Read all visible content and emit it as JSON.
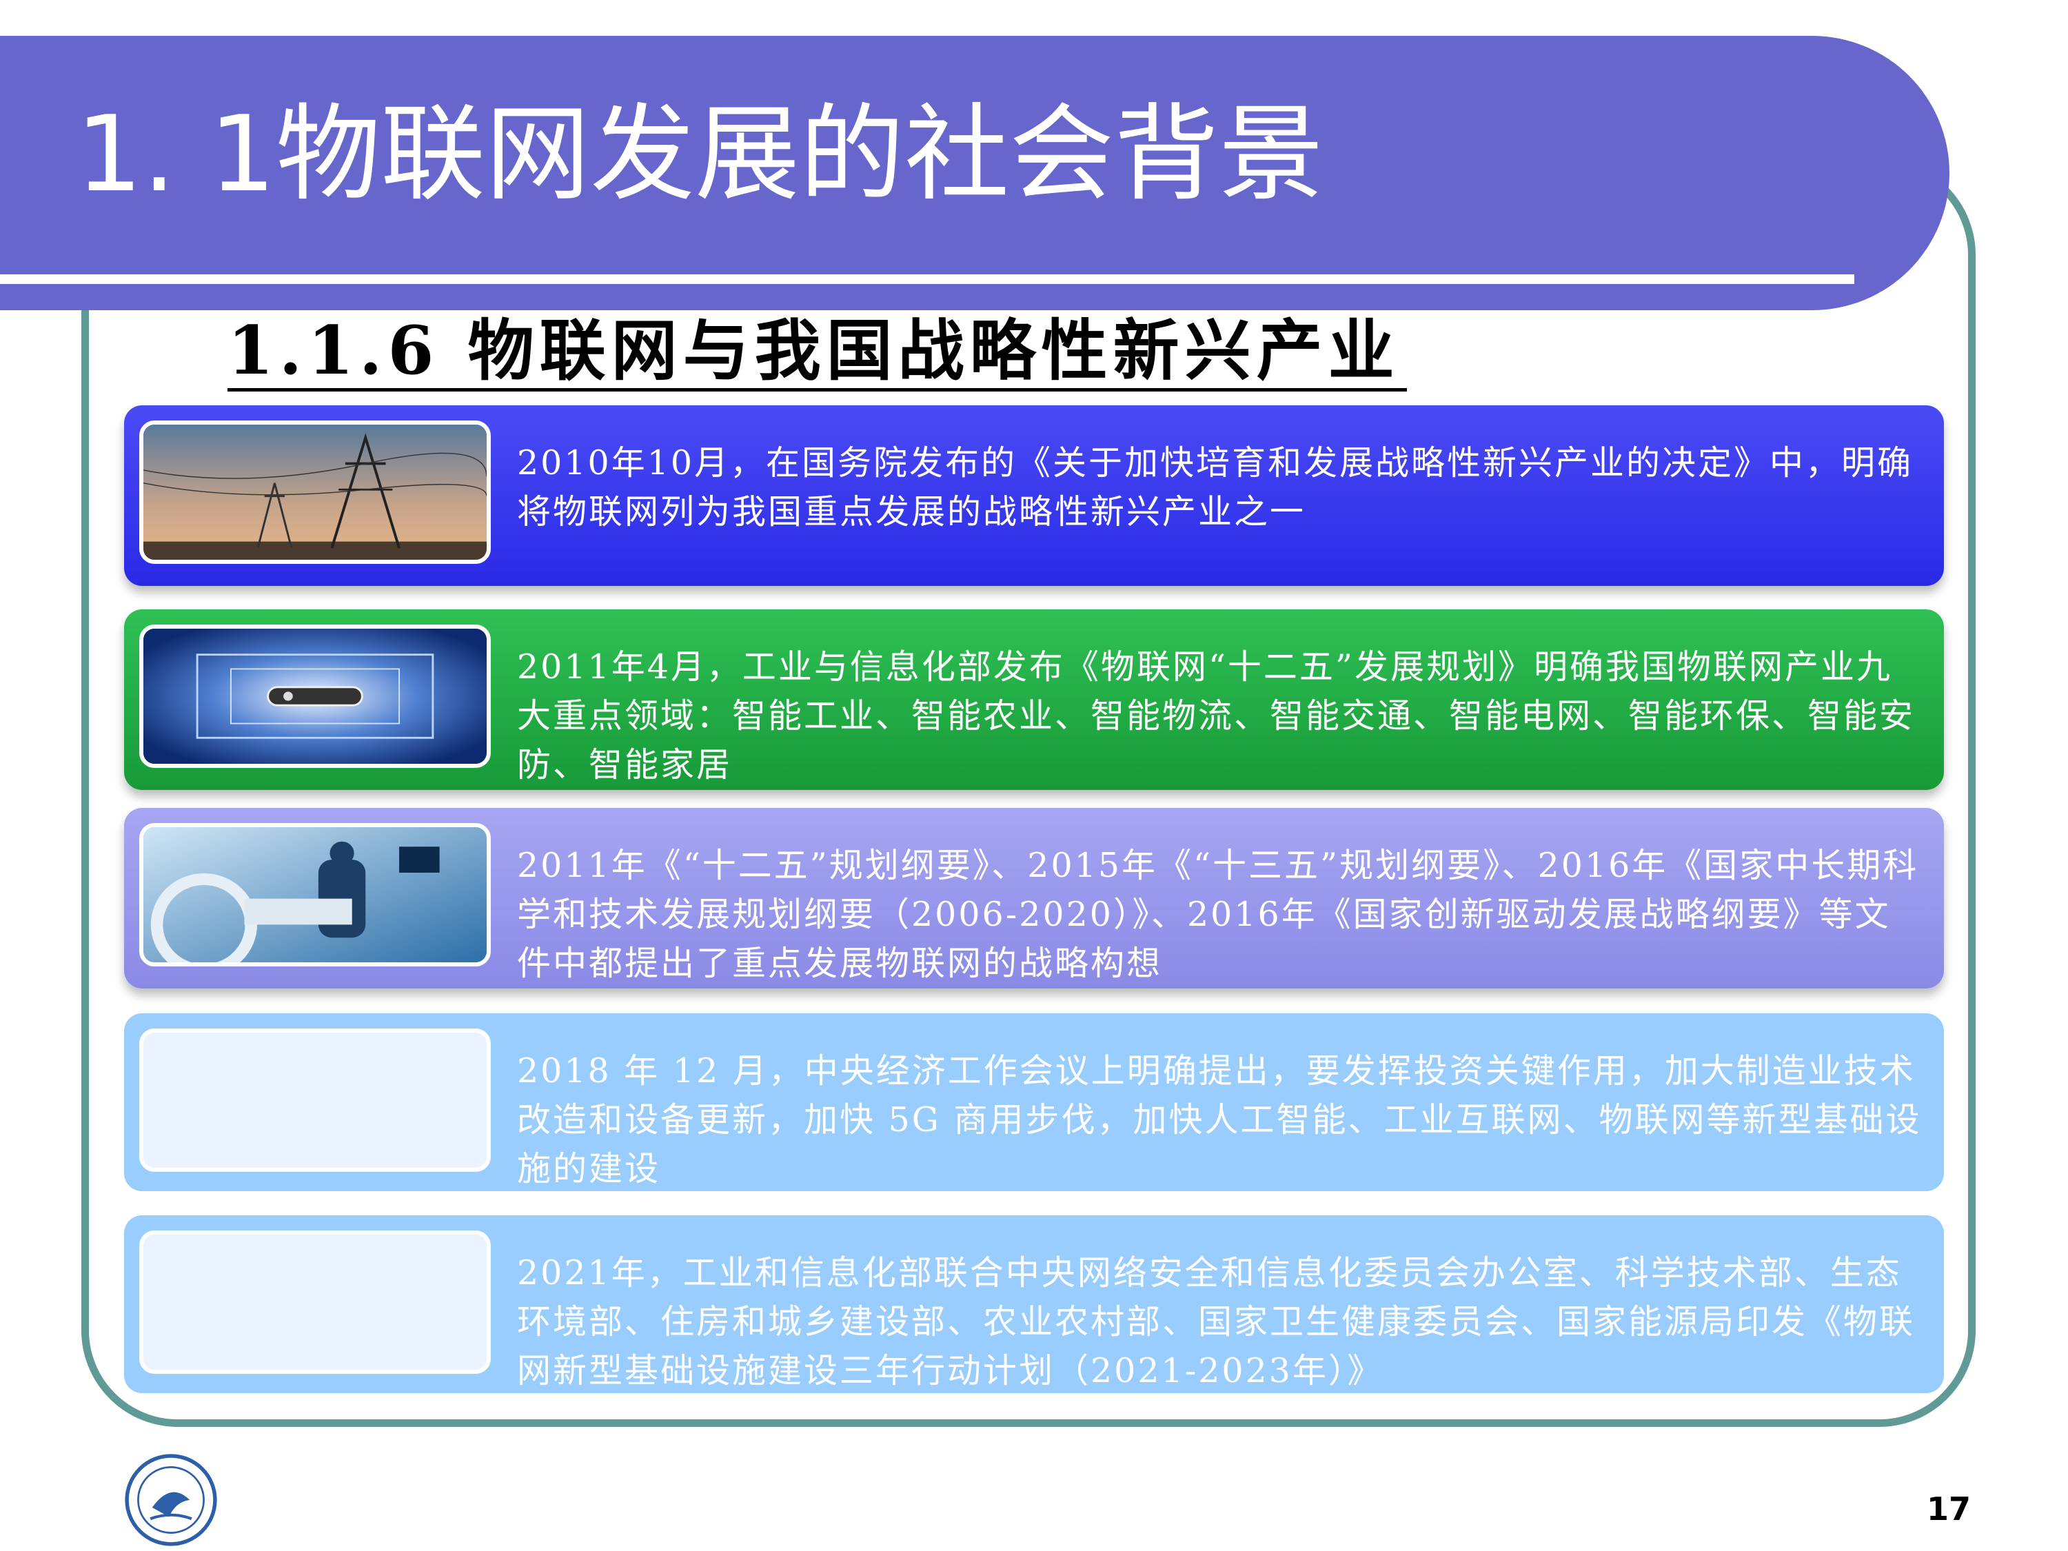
{
  "slide": {
    "title": "1. 1物联网发展的社会背景",
    "subtitle": "1.1.6  物联网与我国战略性新兴产业",
    "page_number": "17"
  },
  "cards": [
    {
      "text": "2010年10月，在国务院发布的《关于加快培育和发展战略性新兴产业的决定》中，明确将物联网列为我国重点发展的战略性新兴产业之一",
      "color": "#3333ee",
      "image": "power-tower-photo"
    },
    {
      "text": "2011年4月，工业与信息化部发布《物联网“十二五”发展规划》明确我国物联网产业九大重点领域：智能工业、智能农业、智能物流、智能交通、智能电网、智能环保、智能安防、智能家居",
      "color": "#22aa44",
      "image": "rfid-chip-photo"
    },
    {
      "text": "2011年《“十二五”规划纲要》、2015年《“十三五”规划纲要》、2016年《国家中长期科学和技术发展规划纲要（2006-2020）》、2016年《国家创新驱动发展战略纲要》等文件中都提出了重点发展物联网的战略构想",
      "color": "#9999ee",
      "image": "hospital-surgery-photo"
    },
    {
      "text": "2018 年 12 月，中央经济工作会议上明确提出，要发挥投资关键作用，加大制造业技术改造和设备更新，加快 5G 商用步伐，加快人工智能、工业互联网、物联网等新型基础设施的建设",
      "color": "#99ccff",
      "image": "blank-placeholder"
    },
    {
      "text": "2021年，工业和信息化部联合中央网络安全和信息化委员会办公室、科学技术部、生态环境部、住房和城乡建设部、农业农村部、国家卫生健康委员会、国家能源局印发《物联网新型基础设施建设三年行动计划（2021-2023年）》",
      "color": "#99ccff",
      "image": "blank-placeholder"
    }
  ]
}
